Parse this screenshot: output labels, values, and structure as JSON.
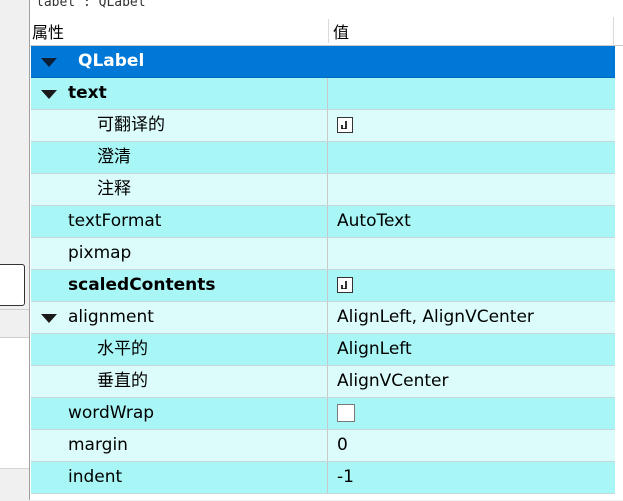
{
  "object_label": "label : QLabel",
  "header": {
    "property": "属性",
    "value": "值"
  },
  "group": {
    "title": "QLabel"
  },
  "rows": [
    {
      "name": "text",
      "value": "",
      "bold": true,
      "expander": true,
      "level": 0,
      "kind": "text"
    },
    {
      "name": "可翻译的",
      "value": "",
      "level": 1,
      "kind": "checkbox",
      "checked": true
    },
    {
      "name": "澄清",
      "value": "",
      "level": 1,
      "kind": "text"
    },
    {
      "name": "注释",
      "value": "",
      "level": 1,
      "kind": "text"
    },
    {
      "name": "textFormat",
      "value": "AutoText",
      "level": 0,
      "kind": "text"
    },
    {
      "name": "pixmap",
      "value": "",
      "level": 0,
      "kind": "text"
    },
    {
      "name": "scaledContents",
      "value": "",
      "bold": true,
      "level": 0,
      "kind": "checkbox",
      "checked": true
    },
    {
      "name": "alignment",
      "value": "AlignLeft, AlignVCenter",
      "expander": true,
      "level": 0,
      "kind": "text"
    },
    {
      "name": "水平的",
      "value": "AlignLeft",
      "level": 1,
      "kind": "text"
    },
    {
      "name": "垂直的",
      "value": "AlignVCenter",
      "level": 1,
      "kind": "text"
    },
    {
      "name": "wordWrap",
      "value": "",
      "level": 0,
      "kind": "checkbox",
      "checked": false
    },
    {
      "name": "margin",
      "value": "0",
      "level": 0,
      "kind": "text"
    },
    {
      "name": "indent",
      "value": "-1",
      "level": 0,
      "kind": "text"
    }
  ],
  "colors": {
    "group": "#0078d7",
    "row_alt": "#a8f6f6",
    "row_norm": "#dcfcfc"
  },
  "icons": {
    "expander": "triangle-down-icon",
    "checked": "checkmark-icon"
  }
}
